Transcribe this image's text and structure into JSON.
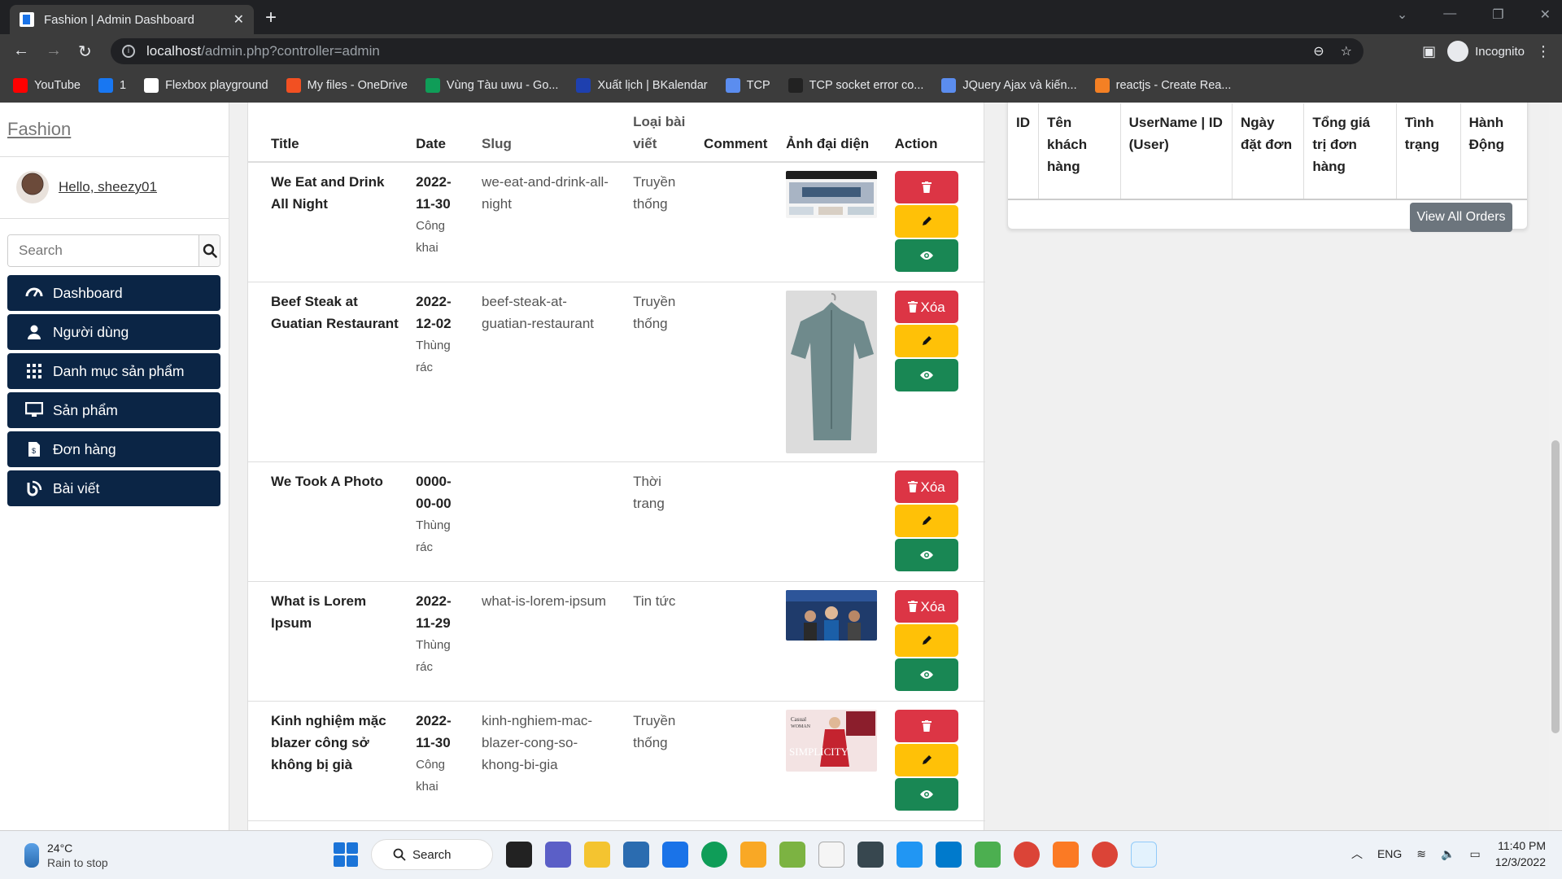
{
  "browser": {
    "tab_title": "Fashion | Admin Dashboard",
    "url_host": "localhost",
    "url_path": "/admin.php?controller=admin",
    "incognito_label": "Incognito"
  },
  "bookmarks": [
    {
      "label": "YouTube",
      "icon": "youtube-icon",
      "color": "#ff0000"
    },
    {
      "label": "1",
      "icon": "facebook-icon",
      "color": "#1877f2"
    },
    {
      "label": "Flexbox playground",
      "icon": "flexbox-icon",
      "color": "#ffffff"
    },
    {
      "label": "My files - OneDrive",
      "icon": "microsoft-icon",
      "color": "#f25022"
    },
    {
      "label": "Vùng Tàu uwu - Go...",
      "icon": "sheets-icon",
      "color": "#0f9d58"
    },
    {
      "label": "Xuất lịch | BKalendar",
      "icon": "bkalendar-icon",
      "color": "#1e40af"
    },
    {
      "label": "TCP",
      "icon": "v-icon",
      "color": "#5b8def"
    },
    {
      "label": "TCP socket error co...",
      "icon": "github-icon",
      "color": "#222222"
    },
    {
      "label": "JQuery Ajax và kiến...",
      "icon": "v-icon",
      "color": "#5b8def"
    },
    {
      "label": "reactjs - Create Rea...",
      "icon": "stackoverflow-icon",
      "color": "#f48024"
    }
  ],
  "sidebar": {
    "brand": "Fashion",
    "greeting": "Hello, sheezy01",
    "search_placeholder": "Search",
    "items": [
      {
        "label": "Dashboard",
        "icon": "dashboard-icon"
      },
      {
        "label": "Người dùng",
        "icon": "user-icon"
      },
      {
        "label": "Danh mục sản phẩm",
        "icon": "grid-icon"
      },
      {
        "label": "Sản phẩm",
        "icon": "monitor-icon"
      },
      {
        "label": "Đơn hàng",
        "icon": "invoice-icon"
      },
      {
        "label": "Bài viết",
        "icon": "blog-icon"
      }
    ]
  },
  "posts_table": {
    "headers": [
      "Title",
      "Date",
      "Slug",
      "Loại bài viết",
      "Comment",
      "Ảnh đại diện",
      "Action"
    ],
    "delete_label": "Xóa",
    "rows": [
      {
        "title": "We Eat and Drink All Night",
        "date": "2022-11-30",
        "status": "Công khai",
        "slug": "we-eat-and-drink-all-night",
        "type": "Truyền thống",
        "comment": "",
        "image": "website-screenshot",
        "delete_text": false
      },
      {
        "title": "Beef Steak at Guatian Restaurant",
        "date": "2022-12-02",
        "status": "Thùng rác",
        "slug": "beef-steak-at-guatian-restaurant",
        "type": "Truyền thống",
        "comment": "",
        "image": "grey-shirt",
        "delete_text": true
      },
      {
        "title": "We Took A Photo",
        "date": "0000-00-00",
        "status": "Thùng rác",
        "slug": "",
        "type": "Thời trang",
        "comment": "",
        "image": "",
        "delete_text": true
      },
      {
        "title": "What is Lorem Ipsum",
        "date": "2022-11-29",
        "status": "Thùng rác",
        "slug": "what-is-lorem-ipsum",
        "type": "Tin tức",
        "comment": "",
        "image": "crowd-photo",
        "delete_text": true
      },
      {
        "title": "Kinh nghiệm mặc blazer công sở không bị già",
        "date": "2022-11-30",
        "status": "Công khai",
        "slug": "kinh-nghiem-mac-blazer-cong-so-khong-bi-gia",
        "type": "Truyền thống",
        "comment": "",
        "image": "simplicity-magazine",
        "delete_text": false
      }
    ]
  },
  "orders_table": {
    "headers": [
      "ID",
      "Tên khách hàng",
      "UserName | ID (User)",
      "Ngày đặt đơn",
      "Tổng giá trị đơn hàng",
      "Tình trạng",
      "Hành Động"
    ],
    "view_all_label": "View All Orders"
  },
  "taskbar": {
    "temperature": "24°C",
    "weather": "Rain to stop",
    "search_label": "Search",
    "language": "ENG",
    "time": "11:40 PM",
    "date": "12/3/2022"
  }
}
